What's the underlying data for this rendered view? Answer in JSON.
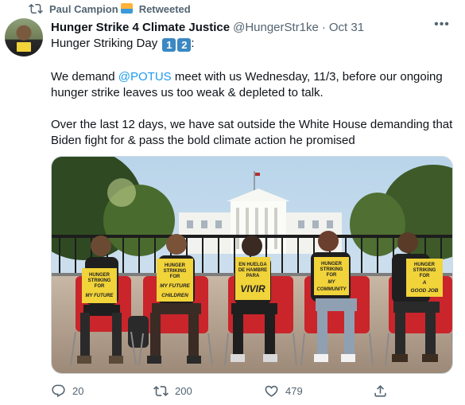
{
  "retweet": {
    "user": "Paul Campion",
    "label": "Retweeted",
    "emoji": "sun-behind-water-emoji"
  },
  "author": {
    "name": "Hunger Strike 4 Climate Justice",
    "handle": "@HungerStr1ke",
    "separator": "·",
    "date": "Oct 31"
  },
  "tweet": {
    "line1_prefix": "Hunger Striking Day",
    "keycap1": "1",
    "keycap2": "2",
    "line1_suffix": ":",
    "para2_before": "We demand ",
    "para2_mention": "@POTUS",
    "para2_after": " meet with us Wednesday, 11/3, before our ongoing hunger strike leaves us too weak & depleted to talk.",
    "para3": "Over the last 12 days, we have sat outside the White House demanding that Biden fight for & pass the bold climate action he promised"
  },
  "media": {
    "signs": [
      [
        "HUNGER",
        "STRIKING",
        "FOR",
        "MY FUTURE"
      ],
      [
        "HUNGER",
        "STRIKING",
        "FOR",
        "MY FUTURE",
        "CHILDREN"
      ],
      [
        "EN HUELGA",
        "DE HAMBRE",
        "PARA",
        "VIVIR"
      ],
      [
        "HUNGER",
        "STRIKING",
        "FOR",
        "MY",
        "COMMUNITY"
      ],
      [
        "HUNGER",
        "STRIKING",
        "FOR",
        "A",
        "GOOD JOB"
      ]
    ]
  },
  "actions": {
    "replies": "20",
    "retweets": "200",
    "likes": "479"
  },
  "colors": {
    "accent": "#1d9bf0",
    "muted": "#536471",
    "text": "#0f1419",
    "keycap": "#3b88c3",
    "sign": "#f1d33a"
  }
}
